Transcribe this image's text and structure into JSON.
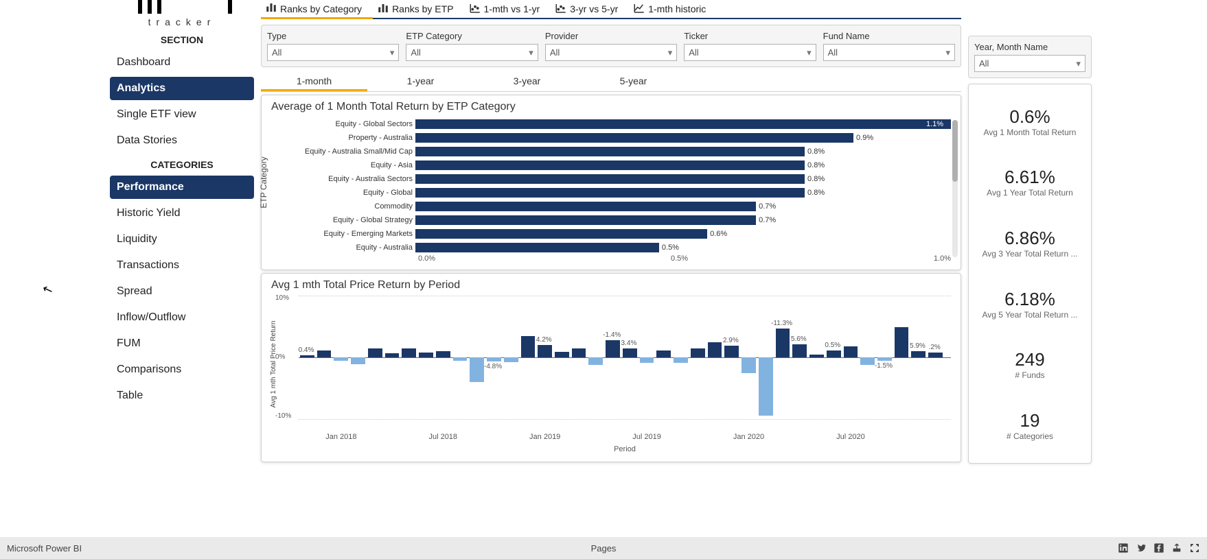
{
  "logo": {
    "text": "tracker"
  },
  "sections": {
    "top_label": "SECTION",
    "cat_label": "CATEGORIES",
    "top": [
      {
        "label": "Dashboard",
        "active": false
      },
      {
        "label": "Analytics",
        "active": true
      },
      {
        "label": "Single ETF view",
        "active": false
      },
      {
        "label": "Data Stories",
        "active": false
      }
    ],
    "cat": [
      {
        "label": "Performance",
        "active": true
      },
      {
        "label": "Historic Yield",
        "active": false
      },
      {
        "label": "Liquidity",
        "active": false
      },
      {
        "label": "Transactions",
        "active": false
      },
      {
        "label": "Spread",
        "active": false
      },
      {
        "label": "Inflow/Outflow",
        "active": false
      },
      {
        "label": "FUM",
        "active": false
      },
      {
        "label": "Comparisons",
        "active": false
      },
      {
        "label": "Table",
        "active": false
      }
    ]
  },
  "tabs": [
    {
      "label": "Ranks by Category",
      "active": true
    },
    {
      "label": "Ranks by ETP",
      "active": false
    },
    {
      "label": "1-mth vs 1-yr",
      "active": false
    },
    {
      "label": "3-yr vs 5-yr",
      "active": false
    },
    {
      "label": "1-mth historic",
      "active": false
    }
  ],
  "filters": [
    {
      "label": "Type",
      "value": "All"
    },
    {
      "label": "ETP Category",
      "value": "All"
    },
    {
      "label": "Provider",
      "value": "All"
    },
    {
      "label": "Ticker",
      "value": "All"
    },
    {
      "label": "Fund Name",
      "value": "All"
    }
  ],
  "year_filter": {
    "label": "Year, Month Name",
    "value": "All"
  },
  "period_tabs": [
    {
      "label": "1-month",
      "active": true
    },
    {
      "label": "1-year",
      "active": false
    },
    {
      "label": "3-year",
      "active": false
    },
    {
      "label": "5-year",
      "active": false
    }
  ],
  "chart_data": [
    {
      "type": "bar",
      "orientation": "horizontal",
      "title": "Average of 1 Month Total Return by ETP Category",
      "ylabel": "ETP Category",
      "xlabel": "",
      "xlim": [
        0,
        1.1
      ],
      "x_ticks": [
        "0.0%",
        "0.5%",
        "1.0%"
      ],
      "categories": [
        "Equity - Global Sectors",
        "Property - Australia",
        "Equity - Australia Small/Mid Cap",
        "Equity - Asia",
        "Equity - Australia Sectors",
        "Equity - Global",
        "Commodity",
        "Equity - Global Strategy",
        "Equity - Emerging Markets",
        "Equity - Australia"
      ],
      "values": [
        1.1,
        0.9,
        0.8,
        0.8,
        0.8,
        0.8,
        0.7,
        0.7,
        0.6,
        0.5
      ],
      "value_labels": [
        "1.1%",
        "0.9%",
        "0.8%",
        "0.8%",
        "0.8%",
        "0.8%",
        "0.7%",
        "0.7%",
        "0.6%",
        "0.5%"
      ]
    },
    {
      "type": "bar",
      "orientation": "vertical",
      "title": "Avg 1 mth Total Price Return by Period",
      "ylabel": "Avg 1 mth Total Price Return",
      "xlabel": "Period",
      "ylim": [
        -10,
        10
      ],
      "y_ticks": [
        "10%",
        "0%",
        "-10%"
      ],
      "x_ticks": [
        "Jan 2018",
        "Jul 2018",
        "Jan 2019",
        "Jul 2019",
        "Jan 2020",
        "Jul 2020"
      ],
      "x": [
        "Nov 2017",
        "Dec 2017",
        "Jan 2018",
        "Feb 2018",
        "Mar 2018",
        "Apr 2018",
        "May 2018",
        "Jun 2018",
        "Jul 2018",
        "Aug 2018",
        "Sep 2018",
        "Oct 2018",
        "Nov 2018",
        "Dec 2018",
        "Jan 2019",
        "Feb 2019",
        "Mar 2019",
        "Apr 2019",
        "May 2019",
        "Jun 2019",
        "Jul 2019",
        "Aug 2019",
        "Sep 2019",
        "Oct 2019",
        "Nov 2019",
        "Dec 2019",
        "Jan 2020",
        "Feb 2020",
        "Mar 2020",
        "Apr 2020",
        "May 2020",
        "Jun 2020",
        "Jul 2020",
        "Aug 2020",
        "Sep 2020",
        "Oct 2020",
        "Nov 2020",
        "Dec 2020"
      ],
      "values": [
        0.4,
        1.4,
        -0.7,
        -1.3,
        1.7,
        0.8,
        1.8,
        1.0,
        1.2,
        -0.6,
        -4.8,
        -0.8,
        -0.9,
        4.2,
        2.4,
        1.1,
        1.8,
        -1.4,
        3.4,
        1.8,
        -1.0,
        1.3,
        -1.0,
        1.7,
        2.9,
        2.3,
        -3.1,
        -11.3,
        5.6,
        2.5,
        0.5,
        1.3,
        2.2,
        -1.5,
        -0.7,
        5.9,
        1.2,
        1.0
      ],
      "shown_labels": {
        "0": "0.4%",
        "11": "-4.8%",
        "14": "4.2%",
        "18": "-1.4%",
        "19": "3.4%",
        "25": "2.9%",
        "28": "-11.3%",
        "29": "5.6%",
        "31": "0.5%",
        "34": "-1.5%",
        "36": "5.9%",
        "37": ".2%"
      }
    }
  ],
  "kpis": [
    {
      "value": "0.6%",
      "label": "Avg 1 Month Total Return"
    },
    {
      "value": "6.61%",
      "label": "Avg 1 Year Total Return"
    },
    {
      "value": "6.86%",
      "label": "Avg 3 Year Total Return ..."
    },
    {
      "value": "6.18%",
      "label": "Avg 5 Year Total Return ..."
    },
    {
      "value": "249",
      "label": "# Funds"
    },
    {
      "value": "19",
      "label": "# Categories"
    }
  ],
  "footer": {
    "app": "Microsoft Power BI",
    "center": "Pages"
  }
}
